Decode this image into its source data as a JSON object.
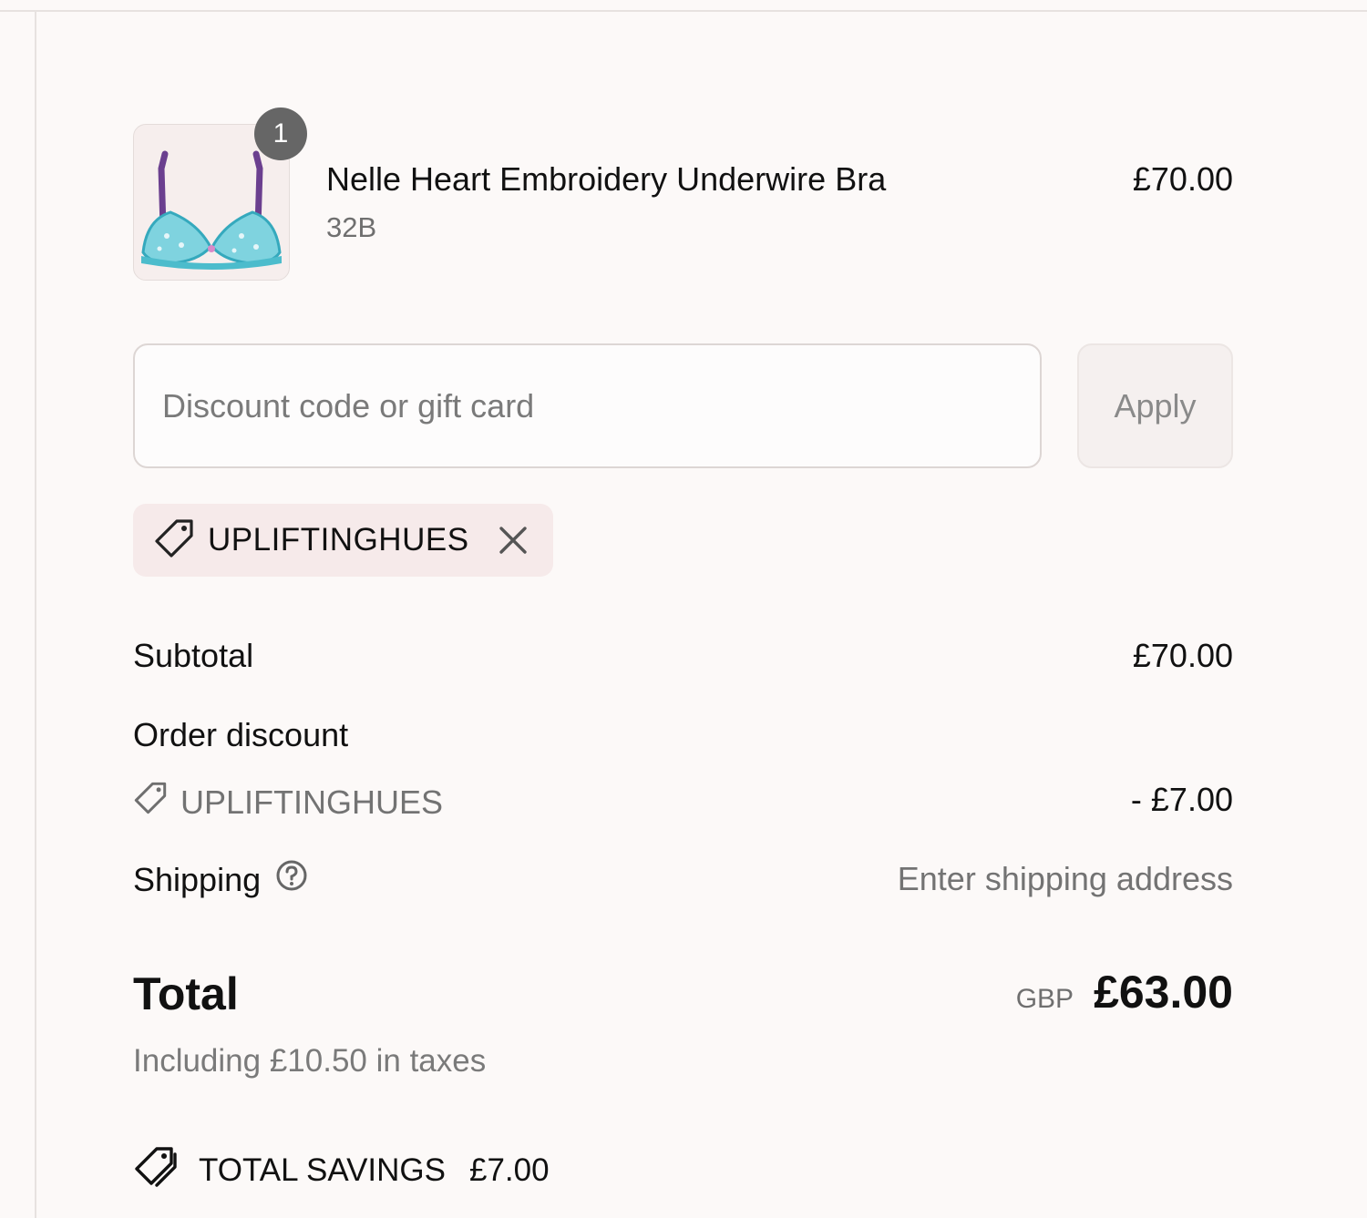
{
  "line_item": {
    "quantity": "1",
    "title": "Nelle Heart Embroidery Underwire Bra",
    "variant": "32B",
    "price": "£70.00",
    "image_icon": "bra-product-thumbnail"
  },
  "discount_form": {
    "placeholder": "Discount code or gift card",
    "value": "",
    "apply_label": "Apply"
  },
  "applied_code": {
    "code": "UPLIFTINGHUES",
    "icon": "tag-icon",
    "remove_icon": "close-icon"
  },
  "summary": {
    "subtotal_label": "Subtotal",
    "subtotal_value": "£70.00",
    "order_discount_label": "Order discount",
    "discount_code": "UPLIFTINGHUES",
    "discount_value": "- £7.00",
    "shipping_label": "Shipping",
    "shipping_value": "Enter shipping address",
    "total_label": "Total",
    "currency": "GBP",
    "total_value": "£63.00",
    "tax_note": "Including £10.50 in taxes",
    "savings_label": "TOTAL SAVINGS",
    "savings_value": "£7.00"
  },
  "colors": {
    "background": "#fcf9f8",
    "pill_background": "#f6eaea",
    "badge": "#666666",
    "muted_text": "#737373"
  }
}
